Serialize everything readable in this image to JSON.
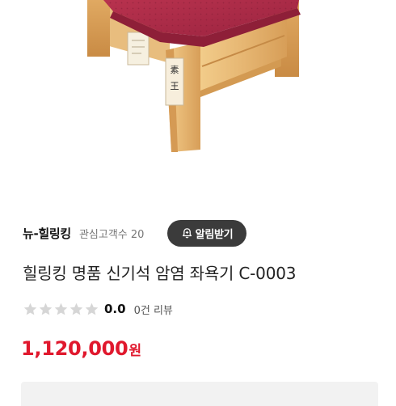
{
  "store": {
    "name": "뉴-힐링킹",
    "fans_text": "관심고객수 20",
    "alert_label": "알림받기"
  },
  "product": {
    "image_icon": "wooden-stool-photo",
    "title": "힐링킹 명품 신기석 암염 좌욕기 C-0003",
    "rating": {
      "stars_filled": 0,
      "stars_total": 5,
      "score": "0.0",
      "reviews_text": "0건 리뷰"
    },
    "price": {
      "amount": "1,120,000",
      "unit": "원"
    }
  },
  "colors": {
    "price": "#e0182d",
    "alert_button_bg": "#3b3b3b",
    "star_empty": "#d6d6d6",
    "panel_bg": "#f2f2f2"
  }
}
